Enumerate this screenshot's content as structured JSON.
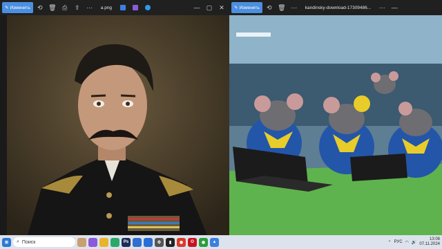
{
  "left_window": {
    "edit_label": "Изменить",
    "filename": "a.png",
    "icons": [
      "rotate-icon",
      "delete-icon",
      "print-icon",
      "share-icon",
      "more-icon"
    ],
    "right_icons": [
      "edit-image-icon",
      "clipchamp-icon",
      "onedrive-icon"
    ],
    "window_controls": [
      "minimize-icon",
      "maximize-icon",
      "close-icon"
    ]
  },
  "right_window": {
    "edit_label": "Изменить",
    "filename": "kandinsky-download-17309486..."
  },
  "taskbar": {
    "search_placeholder": "Поиск",
    "apps": [
      "file-explorer",
      "edge",
      "photoshop",
      "store",
      "mail",
      "settings",
      "terminal",
      "chrome",
      "opera",
      "chrome2",
      "photos"
    ],
    "lang": "РУС",
    "time": "13:08",
    "date": "07.11.2024"
  },
  "colors": {
    "accent": "#4c8fe0",
    "titlebar": "#202020",
    "taskbar": "#dde3ec"
  }
}
